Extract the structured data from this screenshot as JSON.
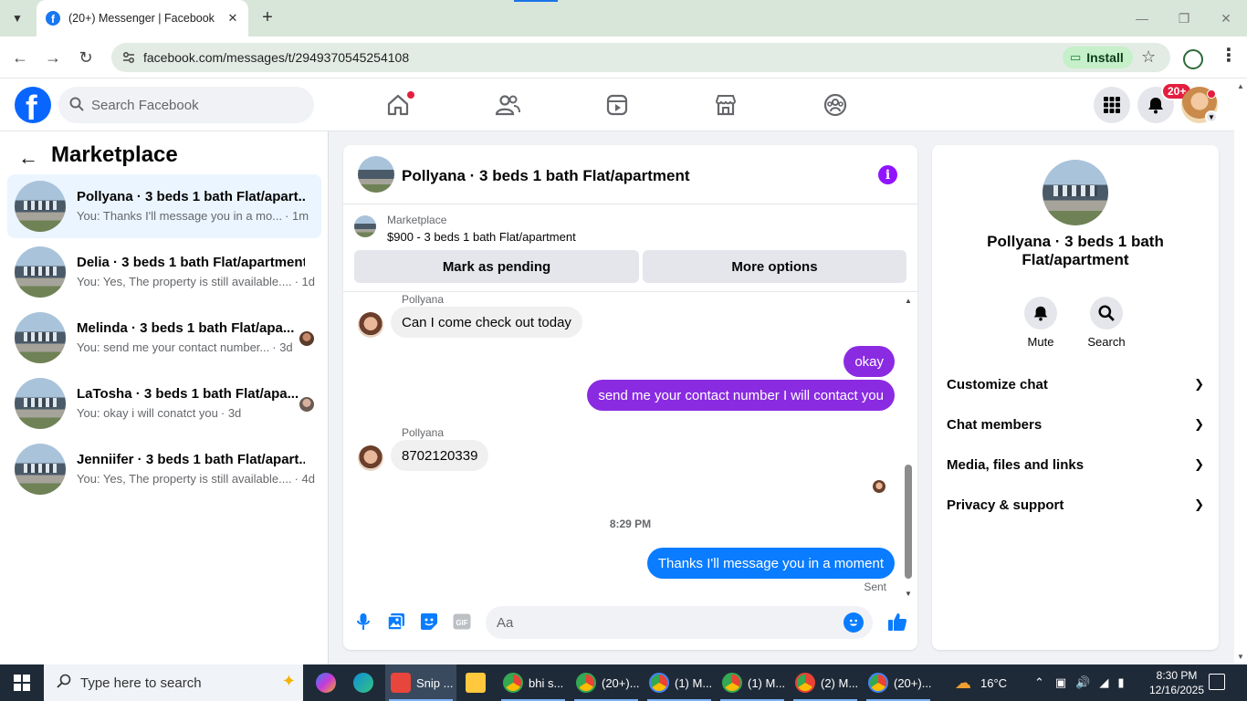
{
  "browser": {
    "tab_title": "(20+) Messenger | Facebook",
    "url": "facebook.com/messages/t/2949370545254108",
    "install_label": "Install"
  },
  "fb": {
    "search_placeholder": "Search Facebook",
    "notification_badge": "20+"
  },
  "left": {
    "title": "Marketplace",
    "conversations": [
      {
        "name": "Pollyana · 3 beds 1 bath Flat/apart...",
        "snippet": "You: Thanks I'll message you in a mo...",
        "time": "· 1m",
        "active": true
      },
      {
        "name": "Delia · 3 beds 1 bath Flat/apartment",
        "snippet": "You: Yes, The property is still available....",
        "time": "· 1d",
        "active": false
      },
      {
        "name": "Melinda · 3 beds 1 bath Flat/apa...",
        "snippet": "You: send me your contact number...",
        "time": "· 3d",
        "active": false
      },
      {
        "name": "LaTosha · 3 beds 1 bath Flat/apa...",
        "snippet": "You: okay i will conatct you",
        "time": "· 3d",
        "active": false
      },
      {
        "name": "Jenniifer · 3 beds 1 bath Flat/apart...",
        "snippet": "You: Yes, The property is still available....",
        "time": "· 4d",
        "active": false
      }
    ]
  },
  "chat": {
    "title": "Pollyana · 3 beds 1 bath Flat/apartment",
    "listing_source": "Marketplace",
    "listing_price": "$900 - 3 beds 1 bath Flat/apartment",
    "mark_pending": "Mark as pending",
    "more_options": "More options",
    "messages": {
      "sender1": "Pollyana",
      "m1": "Can I come check out today",
      "m2": "okay",
      "m3": "send me your contact number I will contact you",
      "sender2": "Pollyana",
      "m4": "8702120339",
      "time_sep": "8:29 PM",
      "m5": "Thanks I'll message you in a moment",
      "status": "Sent"
    },
    "composer_placeholder": "Aa"
  },
  "details": {
    "name": "Pollyana · 3 beds 1 bath Flat/apartment",
    "mute_label": "Mute",
    "search_label": "Search",
    "sections": [
      "Customize chat",
      "Chat members",
      "Media, files and links",
      "Privacy & support"
    ]
  },
  "taskbar": {
    "search_placeholder": "Type here to search",
    "apps": [
      {
        "label": "Snip ...",
        "color": "#e8453c"
      },
      {
        "label": "bhi s...",
        "color": "#34a853"
      },
      {
        "label": "(20+)...",
        "color": "#34a853"
      },
      {
        "label": "(1) M...",
        "color": "#4285f4"
      },
      {
        "label": "(1) M...",
        "color": "#34a853"
      },
      {
        "label": "(2) M...",
        "color": "#ea4335"
      },
      {
        "label": "(20+)...",
        "color": "#4285f4"
      }
    ],
    "temperature": "16°C",
    "time": "8:30 PM",
    "date": "12/16/2025"
  }
}
